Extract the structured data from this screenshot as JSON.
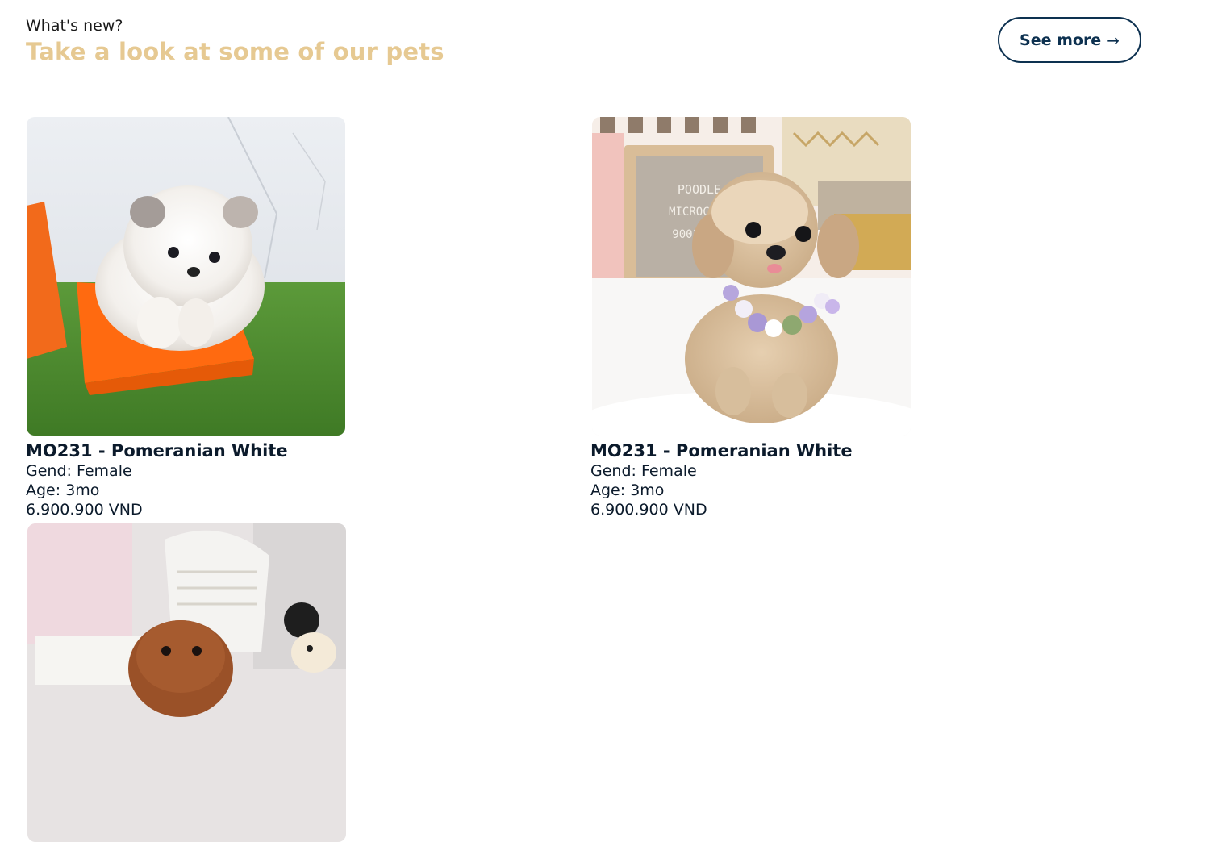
{
  "header": {
    "eyebrow": "What's new?",
    "headline": "Take a look at some of our pets",
    "see_more_label": "See more",
    "see_more_arrow": "→"
  },
  "colors": {
    "headline": "#e6c992",
    "button_border": "#0d3150",
    "text": "#0b1a2b"
  },
  "pets": [
    {
      "title": "MO231 - Pomeranian White",
      "gender_label": "Gend:",
      "gender": "Female",
      "age_label": "Age:",
      "age": "3mo",
      "price": "6.900.900 VND",
      "image": "white pomeranian puppy in orange box on grass"
    },
    {
      "title": "MO231 - Pomeranian White",
      "gender_label": "Gend:",
      "gender": "Female",
      "age_label": "Age:",
      "age": "3mo",
      "price": "6.900.900 VND",
      "image": "cream poodle puppy with flower collar on white fur",
      "sign_lines": [
        "POODLE",
        "MICROCHIP",
        "90011300"
      ]
    },
    {
      "image": "red-brown poodle puppy with toys"
    }
  ]
}
